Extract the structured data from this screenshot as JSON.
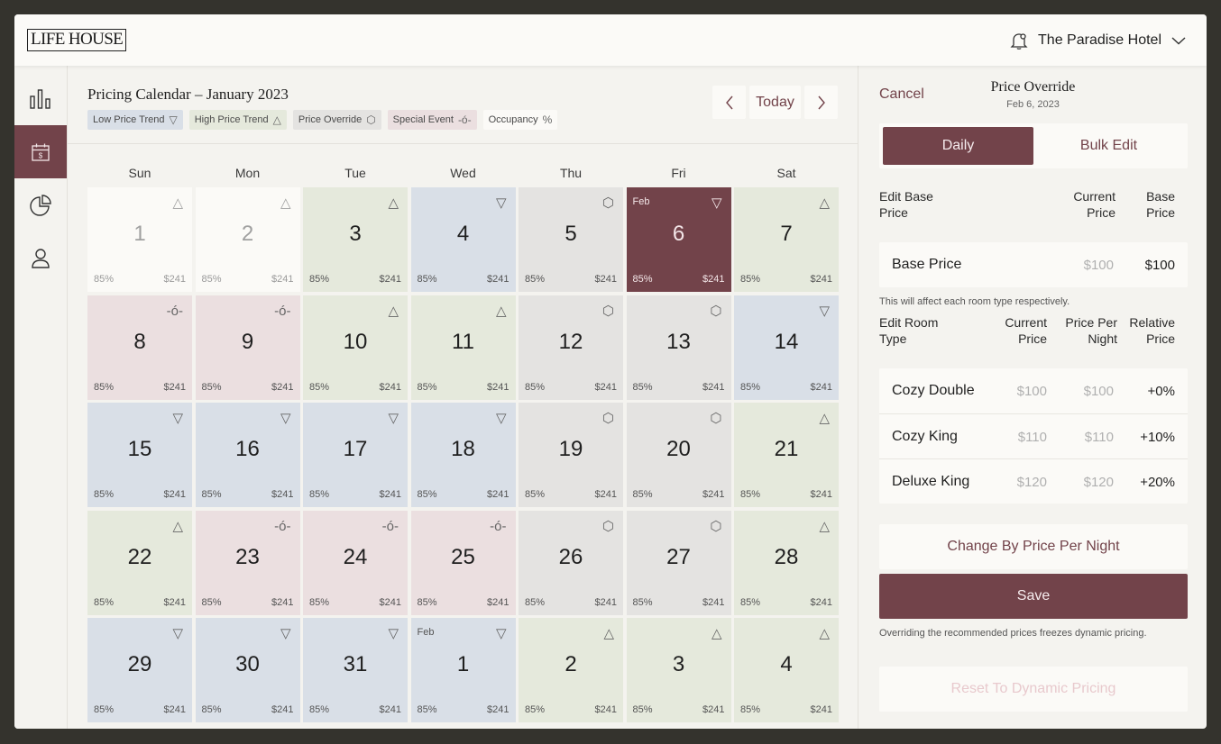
{
  "brand": {
    "logo": "LIFE HOUSE",
    "hotel_name": "The Paradise Hotel",
    "icons": [
      "bell-icon",
      "chevron-down-icon"
    ]
  },
  "sidebar": {
    "items": [
      {
        "icon": "bar-chart-icon",
        "active": false
      },
      {
        "icon": "calendar-dollar-icon",
        "active": true
      },
      {
        "icon": "pie-chart-icon",
        "active": false
      },
      {
        "icon": "user-icon",
        "active": false
      }
    ]
  },
  "calendar": {
    "title": "Pricing Calendar – January 2023",
    "legend": [
      {
        "label": "Low Price Trend",
        "glyph": "▽",
        "color": "#d9dfe7"
      },
      {
        "label": "High Price Trend",
        "glyph": "△",
        "color": "#e5e9dc"
      },
      {
        "label": "Price Override",
        "glyph": "⬡",
        "color": "#e4e3e1"
      },
      {
        "label": "Special Event",
        "glyph": "-ó-",
        "color": "#ebdfe0"
      },
      {
        "label": "Occupancy",
        "glyph": "%",
        "color": "#fbfaf7"
      }
    ],
    "today_label": "Today",
    "weekdays": [
      "Sun",
      "Mon",
      "Tue",
      "Wed",
      "Thu",
      "Fri",
      "Sat"
    ],
    "weeks": [
      [
        {
          "day": "1",
          "type": "white",
          "icon": "△",
          "occ": "85%",
          "price": "$241"
        },
        {
          "day": "2",
          "type": "white",
          "icon": "△",
          "occ": "85%",
          "price": "$241"
        },
        {
          "day": "3",
          "type": "green",
          "icon": "△",
          "occ": "85%",
          "price": "$241"
        },
        {
          "day": "4",
          "type": "blue",
          "icon": "▽",
          "occ": "85%",
          "price": "$241"
        },
        {
          "day": "5",
          "type": "grey",
          "icon": "⬡",
          "occ": "85%",
          "price": "$241"
        },
        {
          "day": "6",
          "type": "sel",
          "icon": "▽",
          "occ": "85%",
          "price": "$241",
          "month": "Feb"
        },
        {
          "day": "7",
          "type": "green",
          "icon": "△",
          "occ": "85%",
          "price": "$241"
        }
      ],
      [
        {
          "day": "8",
          "type": "pink",
          "icon": "-ó-",
          "occ": "85%",
          "price": "$241"
        },
        {
          "day": "9",
          "type": "pink",
          "icon": "-ó-",
          "occ": "85%",
          "price": "$241"
        },
        {
          "day": "10",
          "type": "green",
          "icon": "△",
          "occ": "85%",
          "price": "$241"
        },
        {
          "day": "11",
          "type": "green",
          "icon": "△",
          "occ": "85%",
          "price": "$241"
        },
        {
          "day": "12",
          "type": "grey",
          "icon": "⬡",
          "occ": "85%",
          "price": "$241"
        },
        {
          "day": "13",
          "type": "grey",
          "icon": "⬡",
          "occ": "85%",
          "price": "$241"
        },
        {
          "day": "14",
          "type": "blue",
          "icon": "▽",
          "occ": "85%",
          "price": "$241"
        }
      ],
      [
        {
          "day": "15",
          "type": "blue",
          "icon": "▽",
          "occ": "85%",
          "price": "$241"
        },
        {
          "day": "16",
          "type": "blue",
          "icon": "▽",
          "occ": "85%",
          "price": "$241"
        },
        {
          "day": "17",
          "type": "blue",
          "icon": "▽",
          "occ": "85%",
          "price": "$241"
        },
        {
          "day": "18",
          "type": "blue",
          "icon": "▽",
          "occ": "85%",
          "price": "$241"
        },
        {
          "day": "19",
          "type": "grey",
          "icon": "⬡",
          "occ": "85%",
          "price": "$241"
        },
        {
          "day": "20",
          "type": "grey",
          "icon": "⬡",
          "occ": "85%",
          "price": "$241"
        },
        {
          "day": "21",
          "type": "green",
          "icon": "△",
          "occ": "85%",
          "price": "$241"
        }
      ],
      [
        {
          "day": "22",
          "type": "green",
          "icon": "△",
          "occ": "85%",
          "price": "$241"
        },
        {
          "day": "23",
          "type": "pink",
          "icon": "-ó-",
          "occ": "85%",
          "price": "$241"
        },
        {
          "day": "24",
          "type": "pink",
          "icon": "-ó-",
          "occ": "85%",
          "price": "$241"
        },
        {
          "day": "25",
          "type": "pink",
          "icon": "-ó-",
          "occ": "85%",
          "price": "$241"
        },
        {
          "day": "26",
          "type": "grey",
          "icon": "⬡",
          "occ": "85%",
          "price": "$241"
        },
        {
          "day": "27",
          "type": "grey",
          "icon": "⬡",
          "occ": "85%",
          "price": "$241"
        },
        {
          "day": "28",
          "type": "green",
          "icon": "△",
          "occ": "85%",
          "price": "$241"
        }
      ],
      [
        {
          "day": "29",
          "type": "blue",
          "icon": "▽",
          "occ": "85%",
          "price": "$241"
        },
        {
          "day": "30",
          "type": "blue",
          "icon": "▽",
          "occ": "85%",
          "price": "$241"
        },
        {
          "day": "31",
          "type": "blue",
          "icon": "▽",
          "occ": "85%",
          "price": "$241"
        },
        {
          "day": "1",
          "type": "blue",
          "icon": "▽",
          "occ": "85%",
          "price": "$241",
          "month": "Feb"
        },
        {
          "day": "2",
          "type": "green",
          "icon": "△",
          "occ": "85%",
          "price": "$241"
        },
        {
          "day": "3",
          "type": "green",
          "icon": "△",
          "occ": "85%",
          "price": "$241"
        },
        {
          "day": "4",
          "type": "green",
          "icon": "△",
          "occ": "85%",
          "price": "$241"
        }
      ]
    ]
  },
  "panel": {
    "cancel": "Cancel",
    "title": "Price Override",
    "date": "Feb 6, 2023",
    "tabs": {
      "daily": "Daily",
      "bulk": "Bulk Edit"
    },
    "base": {
      "h1a": "Edit Base",
      "h1b": "Price",
      "h2a": "Current",
      "h2b": "Price",
      "h3a": "Base",
      "h3b": "Price",
      "name": "Base Price",
      "current": "$100",
      "value": "$100",
      "note": "This will affect each room type respectively."
    },
    "rooms": {
      "h1a": "Edit Room",
      "h1b": "Type",
      "h2a": "Current",
      "h2b": "Price",
      "h3a": "Price Per",
      "h3b": "Night",
      "h4a": "Relative",
      "h4b": "Price",
      "items": [
        {
          "name": "Cozy Double",
          "current": "$100",
          "per_night": "$100",
          "relative": "+0%"
        },
        {
          "name": "Cozy King",
          "current": "$110",
          "per_night": "$110",
          "relative": "+10%"
        },
        {
          "name": "Deluxe King",
          "current": "$120",
          "per_night": "$120",
          "relative": "+20%"
        }
      ]
    },
    "change_btn": "Change By Price Per Night",
    "save_btn": "Save",
    "save_note": "Overriding the recommended prices freezes dynamic pricing.",
    "reset_btn": "Reset To Dynamic Pricing"
  }
}
